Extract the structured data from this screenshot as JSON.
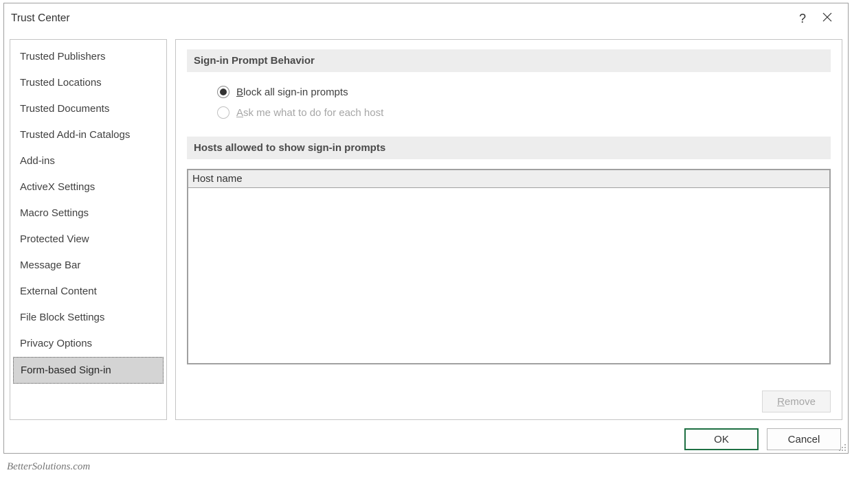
{
  "dialog": {
    "title": "Trust Center"
  },
  "sidebar": {
    "items": [
      {
        "label": "Trusted Publishers",
        "selected": false
      },
      {
        "label": "Trusted Locations",
        "selected": false
      },
      {
        "label": "Trusted Documents",
        "selected": false
      },
      {
        "label": "Trusted Add-in Catalogs",
        "selected": false
      },
      {
        "label": "Add-ins",
        "selected": false
      },
      {
        "label": "ActiveX Settings",
        "selected": false
      },
      {
        "label": "Macro Settings",
        "selected": false
      },
      {
        "label": "Protected View",
        "selected": false
      },
      {
        "label": "Message Bar",
        "selected": false
      },
      {
        "label": "External Content",
        "selected": false
      },
      {
        "label": "File Block Settings",
        "selected": false
      },
      {
        "label": "Privacy Options",
        "selected": false
      },
      {
        "label": "Form-based Sign-in",
        "selected": true
      }
    ]
  },
  "content": {
    "section1_heading": "Sign-in Prompt Behavior",
    "radio_block_prefix": "B",
    "radio_block_rest": "lock all sign-in prompts",
    "radio_ask_prefix": "A",
    "radio_ask_rest": "sk me what to do for each host",
    "radio_selected": "block",
    "section2_heading": "Hosts allowed to show sign-in prompts",
    "hosts_header": "Host name",
    "hosts": []
  },
  "buttons": {
    "remove_prefix": "R",
    "remove_rest": "emove",
    "ok": "OK",
    "cancel": "Cancel"
  },
  "watermark": "BetterSolutions.com"
}
